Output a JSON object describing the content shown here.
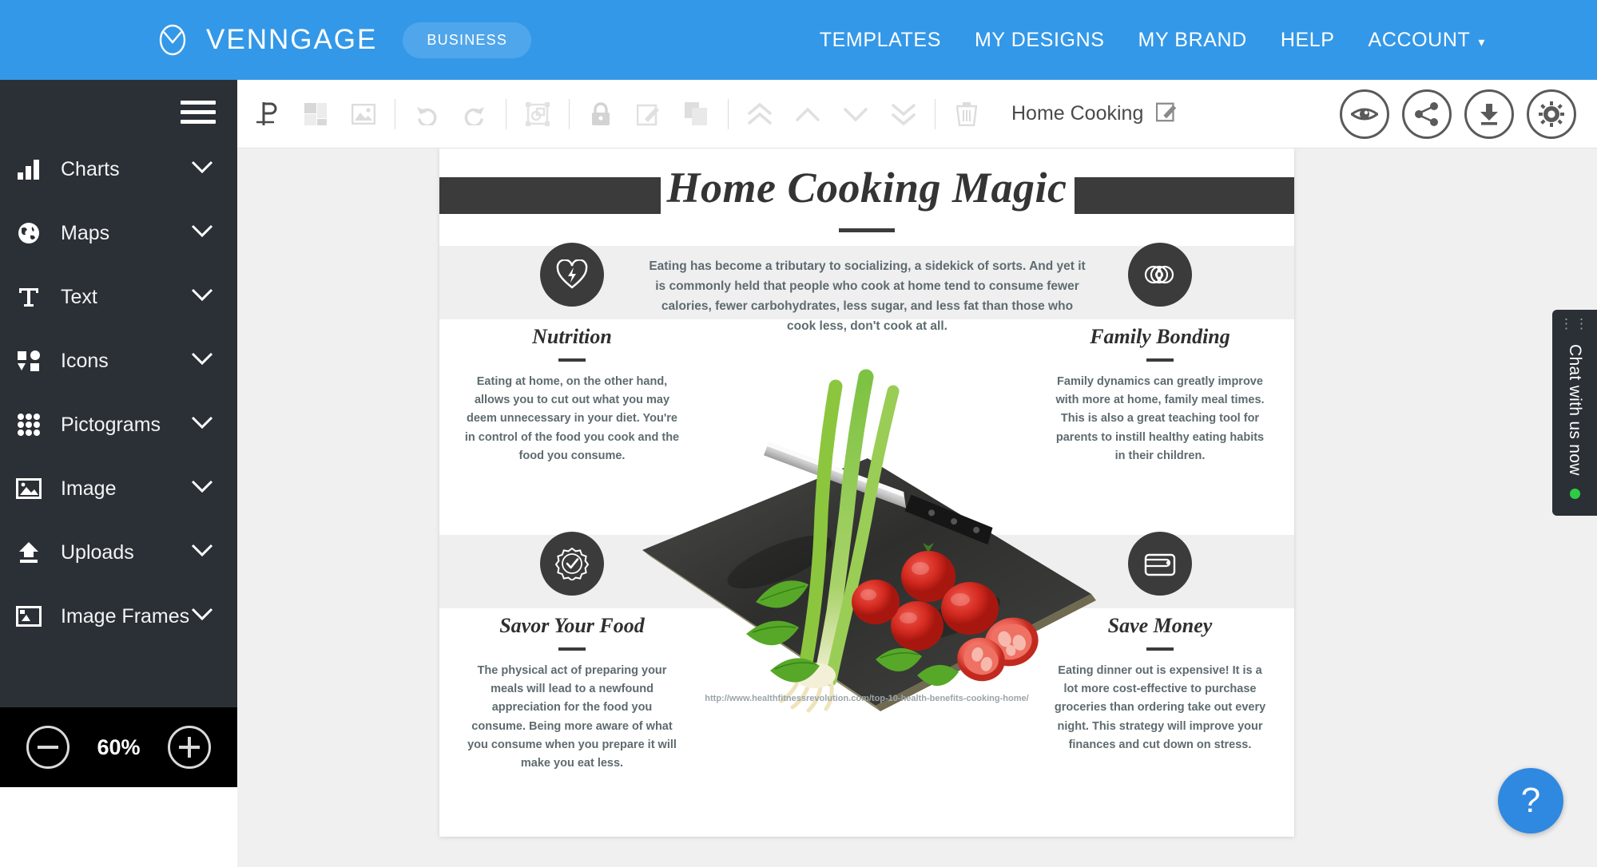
{
  "topnav": {
    "brand_name": "VENNGAGE",
    "badge": "BUSINESS",
    "links": [
      {
        "label": "TEMPLATES"
      },
      {
        "label": "MY DESIGNS"
      },
      {
        "label": "MY BRAND"
      },
      {
        "label": "HELP"
      },
      {
        "label": "ACCOUNT"
      }
    ],
    "account_caret": "▾",
    "bg_color": "#3498e8"
  },
  "sidebar": {
    "bg_color": "#2b3036",
    "items": [
      {
        "label": "Charts",
        "icon": "bar-chart-icon"
      },
      {
        "label": "Maps",
        "icon": "globe-icon"
      },
      {
        "label": "Text",
        "icon": "text-t-icon"
      },
      {
        "label": "Icons",
        "icon": "shapes-icon"
      },
      {
        "label": "Pictograms",
        "icon": "dot-grid-icon"
      },
      {
        "label": "Image",
        "icon": "picture-icon"
      },
      {
        "label": "Uploads",
        "icon": "upload-arrow-icon"
      },
      {
        "label": "Image Frames",
        "icon": "frame-icon"
      }
    ],
    "zoom": {
      "value": "60%",
      "minus_label": "zoom out",
      "plus_label": "zoom in"
    }
  },
  "toolbar": {
    "document_title": "Home Cooking",
    "tools": [
      {
        "name": "snap-to-grid-icon",
        "active": true
      },
      {
        "name": "layout-grid-icon",
        "active": false
      },
      {
        "name": "background-image-icon",
        "active": false
      },
      {
        "name": "undo-icon",
        "active": false
      },
      {
        "name": "redo-icon",
        "active": false
      },
      {
        "name": "group-objects-icon",
        "active": false
      },
      {
        "name": "lock-icon",
        "active": false
      },
      {
        "name": "edit-icon",
        "active": false
      },
      {
        "name": "duplicate-icon",
        "active": false
      },
      {
        "name": "bring-to-front-icon",
        "active": false
      },
      {
        "name": "move-up-icon",
        "active": false
      },
      {
        "name": "move-down-icon",
        "active": false
      },
      {
        "name": "send-to-back-icon",
        "active": false
      },
      {
        "name": "delete-icon",
        "active": false
      }
    ],
    "actions": [
      {
        "name": "preview-button",
        "icon": "eye-icon"
      },
      {
        "name": "share-button",
        "icon": "share-icon"
      },
      {
        "name": "download-button",
        "icon": "download-icon"
      },
      {
        "name": "settings-button",
        "icon": "gear-icon"
      }
    ]
  },
  "infographic": {
    "title": "Home Cooking Magic",
    "intro": "Eating has become a tributary to socializing, a sidekick of sorts. And yet it is commonly held that people who cook at home tend to consume fewer calories, fewer carbohydrates, less sugar, and less fat than those who cook less, don't cook at all.",
    "source_url": "http://www.healthfitnessrevolution.com/top-10-health-benefits-cooking-home/",
    "accent_dark": "#3b3b3b",
    "band_color": "#efeff0",
    "sections": [
      {
        "title": "Nutrition",
        "icon": "heart-lightning-icon",
        "body": "Eating at home, on the other hand, allows you to cut out what you may deem unnecessary in your diet. You're in control of the food you cook and the food you consume."
      },
      {
        "title": "Family Bonding",
        "icon": "interlocking-rings-icon",
        "body": "Family dynamics can greatly improve with more at home, family meal times. This is also a great teaching tool for parents to instill healthy eating habits in their children."
      },
      {
        "title": "Savor Your Food",
        "icon": "check-badge-icon",
        "body": "The physical act of preparing your meals will lead to a newfound appreciation for the food you consume. Being more aware of what you consume when you prepare it will make you eat less."
      },
      {
        "title": "Save Money",
        "icon": "wallet-icon",
        "body": "Eating dinner out is expensive! It is a lot more cost-effective to purchase groceries than ordering take out every night. This strategy will improve your finances and cut down on stress."
      }
    ]
  },
  "chat_widget": {
    "label": "Chat with us now",
    "grip": "⋮",
    "status_color": "#2ecc45"
  },
  "help_fab": {
    "label": "?"
  }
}
